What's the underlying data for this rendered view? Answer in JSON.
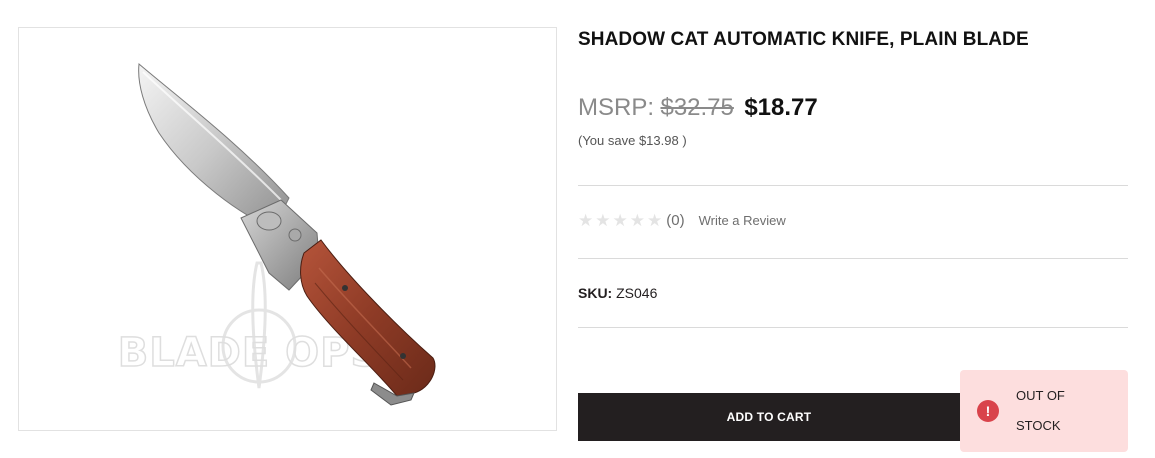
{
  "product": {
    "title": "SHADOW CAT AUTOMATIC KNIFE, PLAIN BLADE",
    "image": {
      "subject": "folding-knife",
      "watermark_text": "BLADE OPS"
    },
    "price": {
      "msrp_label": "MSRP:",
      "msrp_value": "$32.75",
      "sale_price": "$18.77",
      "savings_text": "(You save $13.98 )"
    },
    "rating": {
      "stars": 0,
      "max_stars": 5,
      "count_text": "(0)",
      "write_review_label": "Write a Review"
    },
    "sku": {
      "label": "SKU:",
      "value": "ZS046"
    },
    "add_to_cart_label": "ADD TO CART",
    "stock_alert": {
      "icon": "exclamation-icon",
      "text": "OUT OF STOCK"
    }
  },
  "colors": {
    "button_bg": "#231f20",
    "alert_bg": "#fddede",
    "alert_icon": "#d9434b",
    "strikethrough_price": "#8a8a8a"
  }
}
